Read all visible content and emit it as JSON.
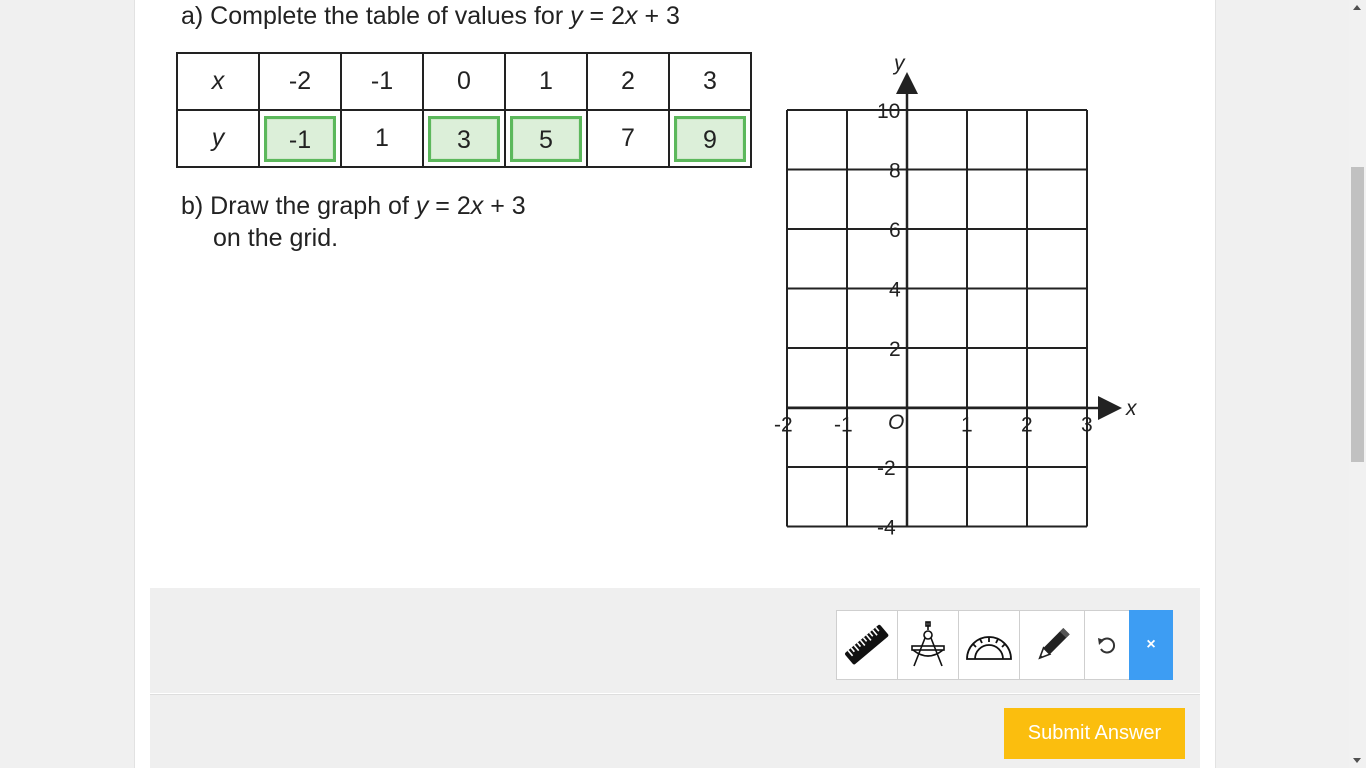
{
  "question": {
    "part_a": {
      "prefix": "a) Complete the table of values for ",
      "var_y": "y",
      "mid": " = 2",
      "var_x": "x",
      "suffix": " + 3"
    },
    "part_b": {
      "line1_prefix": "b) Draw the graph of ",
      "var_y": "y",
      "mid": " = 2",
      "var_x": "x",
      "suffix": " + 3",
      "line2": "on the grid."
    }
  },
  "table": {
    "x_header": "x",
    "y_header": "y",
    "x_values": [
      "-2",
      "-1",
      "0",
      "1",
      "2",
      "3"
    ],
    "y_values": [
      "-1",
      "1",
      "3",
      "5",
      "7",
      "9"
    ],
    "answer_inputs": [
      true,
      false,
      true,
      true,
      false,
      true
    ],
    "input_color": "#5cb85c"
  },
  "graph": {
    "x_axis_label": "x",
    "y_axis_label": "y",
    "origin_label": "O",
    "x_ticks": [
      "-2",
      "-1",
      "1",
      "2",
      "3"
    ],
    "y_ticks": [
      "10",
      "8",
      "6",
      "4",
      "2",
      "-2",
      "-4"
    ],
    "x_range": [
      -2,
      3
    ],
    "y_range": [
      -4,
      10
    ],
    "grid": true
  },
  "toolbar": {
    "tools": [
      "ruler-icon",
      "compass-icon",
      "protractor-icon",
      "pencil-icon",
      "undo-icon"
    ],
    "close_label": "×",
    "close_color": "#3d9df3"
  },
  "submit": {
    "label": "Submit Answer",
    "color": "#fbbe0e"
  }
}
